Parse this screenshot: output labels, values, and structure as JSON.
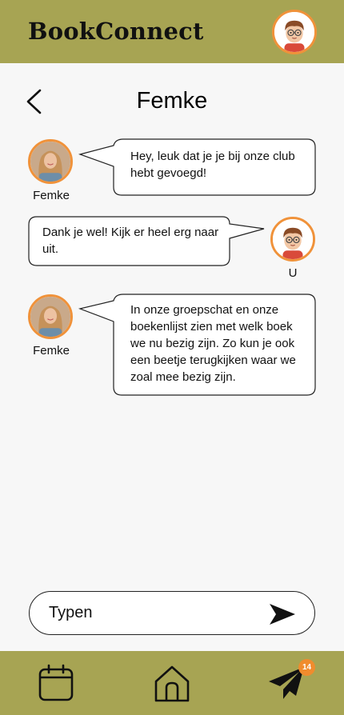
{
  "app": {
    "title": "BookConnect"
  },
  "chat": {
    "title": "Femke"
  },
  "messages": [
    {
      "sender": "Femke",
      "text": "Hey, leuk dat je je bij onze club hebt gevoegd!"
    },
    {
      "sender": "U",
      "text": "Dank je wel! Kijk er heel erg naar uit."
    },
    {
      "sender": "Femke",
      "text": "In onze groepschat en onze boekenlijst zien met welk boek we nu bezig zijn. Zo kun je ook een beetje terugkijken waar we zoal mee bezig zijn."
    }
  ],
  "input": {
    "placeholder": "Typen"
  },
  "nav": {
    "items": [
      {
        "icon": "calendar-icon"
      },
      {
        "icon": "home-icon"
      },
      {
        "icon": "paper-plane-icon",
        "badge": "14"
      }
    ]
  },
  "colors": {
    "bar": "#a7a453",
    "accent": "#f0923a",
    "background": "#f7f7f7"
  }
}
